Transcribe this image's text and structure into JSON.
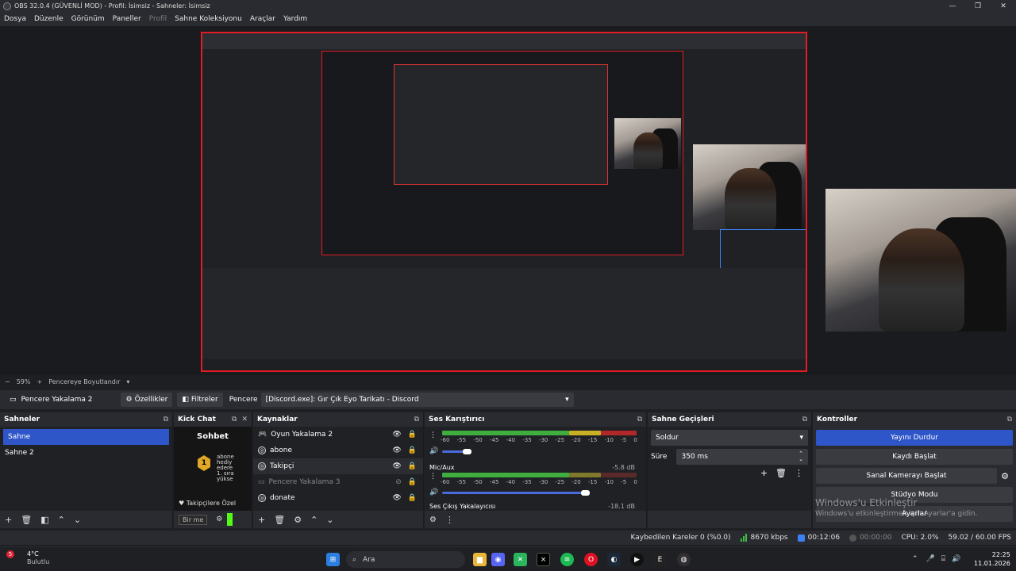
{
  "window": {
    "title": "OBS 32.0.4 (GÜVENLİ MOD) - Profil: İsimsiz - Sahneler: İsimsiz",
    "controls": [
      "—",
      "❐",
      "✕"
    ]
  },
  "menu": {
    "items": [
      "Dosya",
      "Düzenle",
      "Görünüm",
      "Paneller",
      "Profil",
      "Sahne Koleksiyonu",
      "Araçlar",
      "Yardım"
    ]
  },
  "preview_toolbar": {
    "minus": "−",
    "zoom": "59%",
    "plus": "+",
    "fit_label": "Pencereye Boyutlandır",
    "dropdown": "▾"
  },
  "source_toolbar": {
    "source_name": "Pencere Yakalama 2",
    "properties_label": "Özellikler",
    "filters_label": "Filtreler",
    "window_label": "Pencere",
    "window_value": "[Discord.exe]: Gır Çık Eyo Tarikatı - Discord"
  },
  "scenes_dock": {
    "title": "Sahneler",
    "items": [
      "Sahne",
      "Sahne 2"
    ]
  },
  "chat_dock": {
    "title": "Kick Chat",
    "header": "Sohbet",
    "badge": "1",
    "lines": [
      "abone",
      "hediy",
      "edere",
      "1. sıra",
      "yükse"
    ],
    "followers_label": "Takipçilere Özel",
    "input_placeholder": "Bir me"
  },
  "sources_dock": {
    "title": "Kaynaklar",
    "items": [
      {
        "name": "Oyun Yakalama 2",
        "visible": true
      },
      {
        "name": "abone",
        "visible": true
      },
      {
        "name": "Takipçi",
        "visible": true
      },
      {
        "name": "Pencere Yakalama 3",
        "visible": false
      },
      {
        "name": "donate",
        "visible": true
      }
    ]
  },
  "mixer_dock": {
    "title": "Ses Karıştırıcı",
    "scale": [
      "-60",
      "-55",
      "-50",
      "-45",
      "-40",
      "-35",
      "-30",
      "-25",
      "-20",
      "-15",
      "-10",
      "-5",
      "0"
    ],
    "tracks": [
      {
        "name": "",
        "db": "",
        "volume": 0.2
      },
      {
        "name": "Mic/Aux",
        "db": "-5.8 dB",
        "volume": 0.8
      },
      {
        "name": "Ses Çıkış Yakalayıcısı",
        "db": "-18.1 dB",
        "volume": 0.8
      }
    ]
  },
  "transitions_dock": {
    "title": "Sahne Geçişleri",
    "transition": "Soldur",
    "duration_label": "Süre",
    "duration_value": "350 ms"
  },
  "controls_dock": {
    "title": "Kontroller",
    "stop_stream": "Yayını Durdur",
    "start_record": "Kaydı Başlat",
    "virtual_cam": "Sanal Kamerayı Başlat",
    "studio_mode": "Stüdyo Modu",
    "settings": "Ayarlar"
  },
  "watermark": {
    "title": "Windows'u Etkinleştir",
    "subtitle": "Windows'u etkinleştirmek için Ayarlar'a gidin."
  },
  "status": {
    "dropped_frames": "Kaybedilen Kareler 0 (%0.0)",
    "bitrate": "8670 kbps",
    "stream_time": "00:12:06",
    "record_time": "00:00:00",
    "cpu": "CPU: 2.0%",
    "fps": "59.02 / 60.00 FPS"
  },
  "taskbar": {
    "weather_temp": "4°C",
    "weather_desc": "Bulutlu",
    "weather_badge": "5",
    "search_placeholder": "Ara",
    "time": "22:25",
    "date": "11.01.2026"
  },
  "colors": {
    "accent": "#2f56c9",
    "selection": "#e31b23",
    "meter_green": "#3fae3f",
    "meter_yellow": "#c8b025",
    "meter_red": "#b02828"
  }
}
